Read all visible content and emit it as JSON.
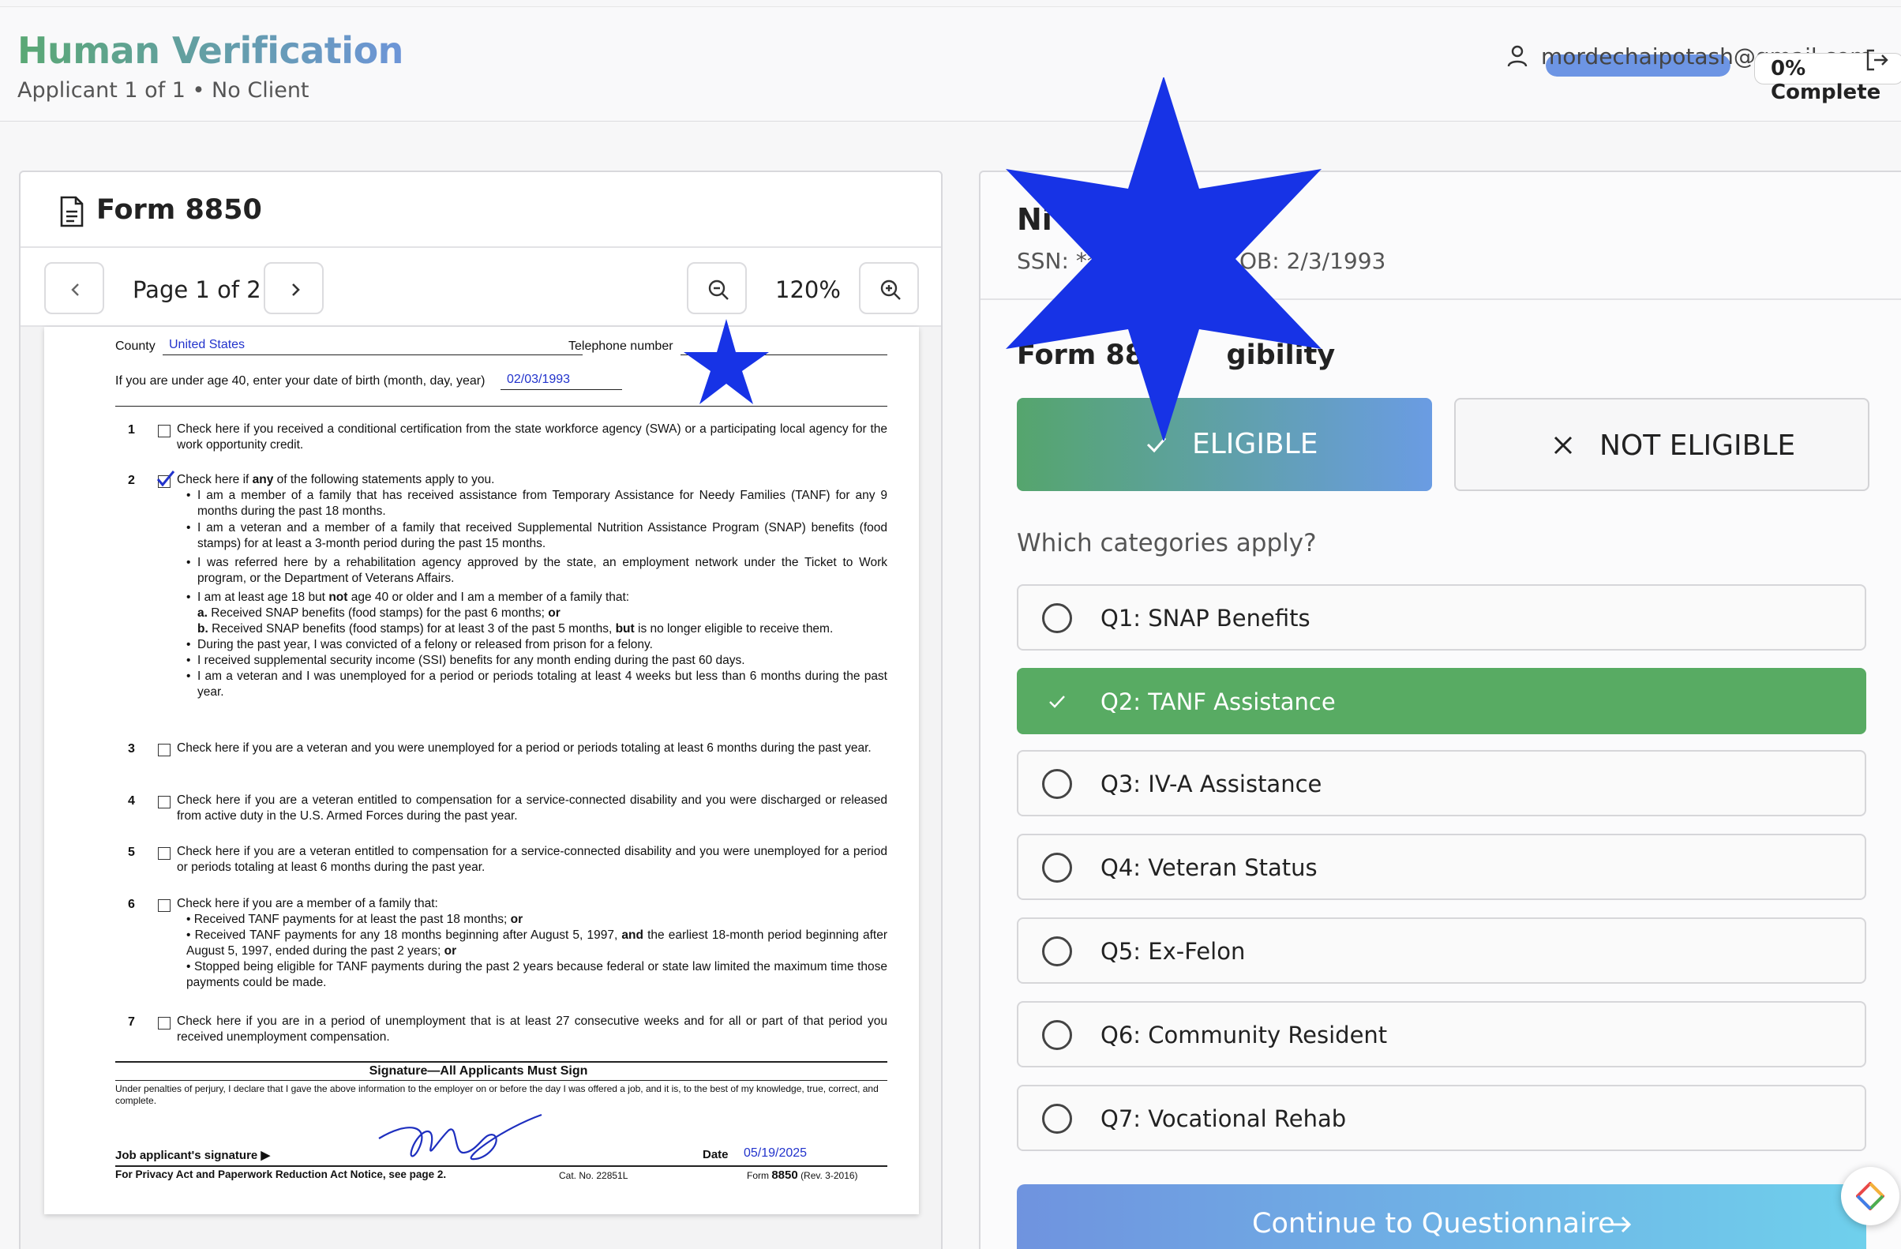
{
  "header": {
    "title": "Human Verification",
    "subtitle": "Applicant 1 of 1 • No Client",
    "user_email": "mordechaipotash@gmail.com",
    "progress_label": "0% Complete",
    "progress_percent": 0
  },
  "document_panel": {
    "title": "Form 8850",
    "page_label": "Page 1 of 2",
    "zoom_label": "120%"
  },
  "form": {
    "county_label": "County",
    "county_value": "United States",
    "telephone_label": "Telephone number",
    "dob_prompt": "If you are under age 40, enter your date of birth (month, day, year)",
    "dob_value": "02/03/1993",
    "questions": [
      {
        "num": "1",
        "checked": false,
        "text": "Check here if you received a conditional certification from the state workforce agency (SWA) or a participating local agency for the work opportunity credit."
      },
      {
        "num": "2",
        "checked": true,
        "intro_pre": "Check here if ",
        "intro_bold": "any",
        "intro_post": " of the following statements apply to you.",
        "bullets": [
          "I am a member of a family that has received assistance from Temporary Assistance for Needy Families (TANF) for any 9 months during the past 18 months.",
          "I am a veteran and a member of a family that received Supplemental Nutrition Assistance Program (SNAP) benefits (food stamps) for at least a 3-month period during the past 15 months.",
          "I was referred here by a rehabilitation agency approved by the state, an employment network under the Ticket to Work program, or the Department of Veterans Affairs."
        ],
        "bullet4_pre": "I am at least age 18 but ",
        "bullet4_bold": "not",
        "bullet4_post": " age 40 or older and I am a member of a family that:",
        "sub_a_label": "a.",
        "sub_a_text": "Received SNAP benefits (food stamps) for the past 6 months;",
        "sub_a_or": "or",
        "sub_b_label": "b.",
        "sub_b_text": "Received SNAP benefits (food stamps) for at least 3 of the past 5 months,",
        "sub_b_but": "but",
        "sub_b_tail": "is no longer eligible to receive them.",
        "bullets2": [
          "During the past year, I was convicted of a felony or released from prison for a felony.",
          "I received supplemental security income (SSI) benefits for any month ending during the past 60 days.",
          "I am a veteran and I was unemployed for a period or periods totaling at least 4 weeks but less than 6 months during the past year."
        ]
      },
      {
        "num": "3",
        "checked": false,
        "text": "Check here if you are a veteran and you were unemployed for a period or periods totaling at least 6 months during the past year."
      },
      {
        "num": "4",
        "checked": false,
        "text": "Check here if you are a veteran entitled to compensation for a service-connected disability and you were discharged or released from active duty in the U.S. Armed Forces during the past year."
      },
      {
        "num": "5",
        "checked": false,
        "text": "Check here if you are a veteran entitled to compensation for a service-connected disability and you were unemployed for a period or periods totaling at least 6 months during the past year."
      },
      {
        "num": "6",
        "checked": false,
        "intro": "Check here if you are a member of a family that:",
        "b1_text": "Received TANF payments for at least the past 18 months;",
        "b1_or": "or",
        "b2_text": "Received TANF payments for any 18 months beginning after August 5, 1997,",
        "b2_and": "and",
        "b2_tail": "the earliest 18-month period beginning after August 5, 1997, ended during the past 2 years;",
        "b2_or": "or",
        "b3_text": "Stopped being eligible for TANF payments during the past 2 years because federal or state law limited the maximum time those payments could be made."
      },
      {
        "num": "7",
        "checked": false,
        "text": "Check here if you are in a period of unemployment that is at least 27 consecutive weeks and for all or part of that period you received unemployment compensation."
      }
    ],
    "signature_title": "Signature—All Applicants Must Sign",
    "perjury_text": "Under penalties of perjury, I declare that I gave the above information to the employer on or before the day I was offered a job, and it is, to the best of my knowledge, true, correct, and complete.",
    "signature_label": "Job applicant's signature ▶",
    "date_label": "Date",
    "date_value": "05/19/2025",
    "privacy_notice": "For Privacy Act and Paperwork Reduction Act Notice, see page 2.",
    "cat_no": "Cat. No. 22851L",
    "form_prefix": "Form",
    "form_number": "8850",
    "form_rev": "(Rev. 3-2016)"
  },
  "applicant": {
    "name": "Ni",
    "ssn_label": "SSN: **",
    "dob_label": "OB: 2/3/1993"
  },
  "eligibility": {
    "title_left": "Form 885",
    "title_right": "gibility",
    "eligible_label": "ELIGIBLE",
    "not_eligible_label": "NOT ELIGIBLE",
    "categories_prompt": "Which categories apply?",
    "categories": [
      {
        "label": "Q1: SNAP Benefits",
        "selected": false
      },
      {
        "label": "Q2: TANF Assistance",
        "selected": true
      },
      {
        "label": "Q3: IV-A Assistance",
        "selected": false
      },
      {
        "label": "Q4: Veteran Status",
        "selected": false
      },
      {
        "label": "Q5: Ex-Felon",
        "selected": false
      },
      {
        "label": "Q6: Community Resident",
        "selected": false
      },
      {
        "label": "Q7: Vocational Rehab",
        "selected": false
      }
    ],
    "continue_label": "Continue to Questionnaire"
  },
  "colors": {
    "brand_green": "#58ab63",
    "brand_blue": "#6d95e4",
    "star_blue": "#1733e6",
    "form_blue": "#2233cc"
  },
  "icons": [
    "user-icon",
    "logout-icon",
    "document-icon",
    "chevron-left-icon",
    "chevron-right-icon",
    "zoom-out-icon",
    "zoom-in-icon",
    "check-icon",
    "x-icon",
    "arrow-right-icon",
    "star-icon"
  ]
}
